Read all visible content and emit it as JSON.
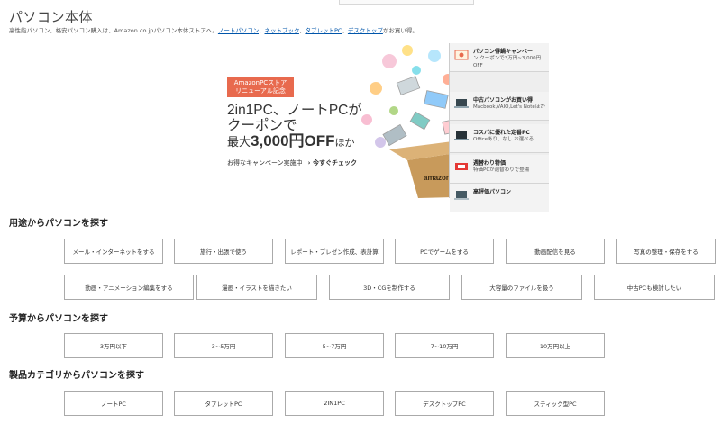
{
  "page": {
    "title": "パソコン本体",
    "intro": {
      "text": "高性能パソコン、格安パソコン購入は、Amazon.co.jpパソコン本体ストアへ。",
      "links": [
        "ノートパソコン",
        "ネットブック",
        "タブレットPC",
        "デスクトップ"
      ],
      "separator": "、",
      "suffix": "がお買い得。"
    }
  },
  "banner": {
    "tag_line1": "AmazonPCストア",
    "tag_line2": "リニューアル記念",
    "headline_line1": "2in1PC、ノートPCが",
    "headline_line2": "クーポンで",
    "headline_pre": "最大",
    "headline_big": "3,000円OFF",
    "headline_post": "ほか",
    "cta_text": "お得なキャンペーン実施中",
    "cta_link": "今すぐチェック",
    "box_text": "amazon.co.jp"
  },
  "side_panel": {
    "items": [
      {
        "title": "パソコン得鍋キャンペー",
        "subtitle": "ン クーポンで3万円~3,000円OFF",
        "icon": "coupon-icon"
      },
      {
        "title": "中古パソコンがお買い得",
        "subtitle": "Macbook,VAIO,Let's Noteほか",
        "icon": "laptop-icon"
      },
      {
        "title": "コスパに優れた定番PC",
        "subtitle": "Officeあり、なし お選べる",
        "icon": "laptop-icon"
      },
      {
        "title": "週替わり特価",
        "subtitle": "特価PCが週替わりで登場",
        "icon": "sale-tag-icon"
      },
      {
        "title": "高評価パソコン",
        "subtitle": "",
        "icon": "laptop-icon"
      }
    ]
  },
  "sections": {
    "usage": {
      "heading": "用途からパソコンを探す",
      "buttons": [
        "メール・インターネットをする",
        "旅行・出張で使う",
        "レポート・プレゼン作成、表計算",
        "PCでゲームをする",
        "動画配信を見る",
        "写真の整理・保存をする",
        "動画・アニメーション編集をする",
        "漫画・イラストを描きたい",
        "3D・CGを制作する",
        "大容量のファイルを扱う",
        "中古PCも検討したい"
      ]
    },
    "budget": {
      "heading": "予算からパソコンを探す",
      "buttons": [
        "3万円以下",
        "3~5万円",
        "5~7万円",
        "7~10万円",
        "10万円以上"
      ]
    },
    "category": {
      "heading": "製品カテゴリからパソコンを探す",
      "buttons": [
        "ノートPC",
        "タブレットPC",
        "2IN1PC",
        "デスクトップPC",
        "スティック型PC"
      ]
    }
  },
  "colors": {
    "tag_bg": "#e86a4e",
    "link": "#0055aa"
  }
}
